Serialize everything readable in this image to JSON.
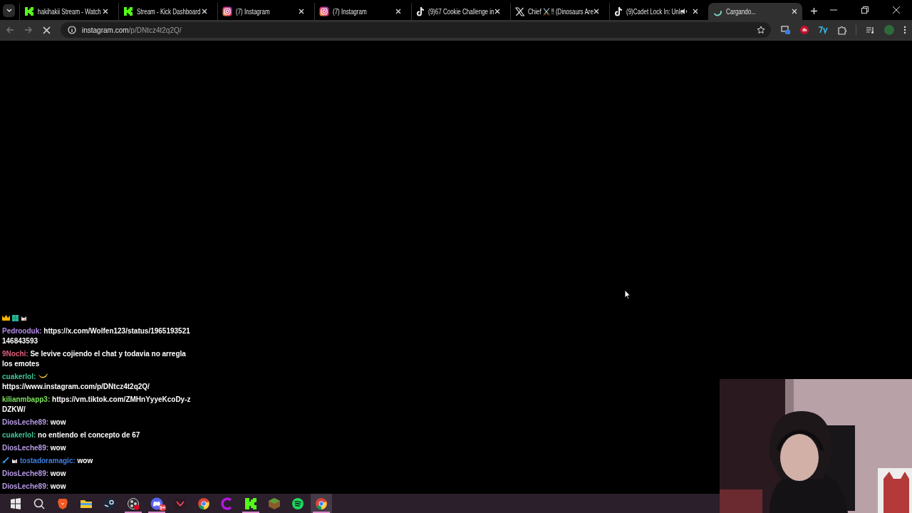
{
  "tabs": [
    {
      "title": "hakihakii Stream - Watch",
      "kind": "kick",
      "audio": false,
      "selected": false
    },
    {
      "title": "Stream - Kick Dashboard",
      "kind": "kick",
      "audio": false,
      "selected": false
    },
    {
      "title": "(7) Instagram",
      "kind": "instagram",
      "audio": false,
      "selected": false
    },
    {
      "title": "(7) Instagram",
      "kind": "instagram",
      "audio": false,
      "selected": false
    },
    {
      "title": "(9)67 Cookie Challenge in",
      "kind": "tiktok",
      "audio": false,
      "selected": false
    },
    {
      "title": "Chief ⚔️ ‼ (Dinosaurs Are",
      "kind": "x",
      "audio": false,
      "selected": false
    },
    {
      "title": "(9)Cadet Lock In: Unle",
      "kind": "tiktok",
      "audio": true,
      "selected": false
    },
    {
      "title": "Cargando...",
      "kind": "loading",
      "audio": false,
      "selected": true
    }
  ],
  "toolbar": {
    "loading": true,
    "host": "instagram.com",
    "path": "/p/DNtcz4t2q2Q/"
  },
  "chat": [
    {
      "kind": "badges",
      "badges": [
        {
          "kind": "crown"
        },
        {
          "kind": "grid"
        },
        {
          "kind": "cat"
        }
      ]
    },
    {
      "kind": "message",
      "user": "Pedrooduk:",
      "color": "#b48bea",
      "text": "https://x.com/Wolfen123/status/1965193521146843593"
    },
    {
      "kind": "message",
      "user": "9Nochi:",
      "color": "#e0607e",
      "text": "Se levive cojiendo el chat y todavia no arregla los emotes"
    },
    {
      "kind": "message",
      "user": "cuakerlol:",
      "color": "#3fc49a",
      "emote": true,
      "text": "https://www.instagram.com/p/DNtcz4t2q2Q/"
    },
    {
      "kind": "message",
      "user": "kilianmbapp3:",
      "color": "#7de25b",
      "text": "https://vm.tiktok.com/ZMHnYyyeKcoDy-zDZKW/"
    },
    {
      "kind": "message",
      "user": "DiosLeche89:",
      "color": "#b89ae6",
      "text": "wow"
    },
    {
      "kind": "message",
      "user": "cuakerlol:",
      "color": "#3fc49a",
      "text": "no entiendo el concepto de 67"
    },
    {
      "kind": "message",
      "user": "DiosLeche89:",
      "color": "#b89ae6",
      "text": "wow"
    },
    {
      "kind": "message",
      "badges": [
        {
          "kind": "sword"
        },
        {
          "kind": "cat"
        }
      ],
      "user": "tostadoramagic:",
      "color": "#3f7fe0",
      "text": "wow"
    },
    {
      "kind": "message",
      "user": "DiosLeche89:",
      "color": "#b89ae6",
      "text": "wow"
    },
    {
      "kind": "message",
      "user": "DiosLeche89:",
      "color": "#b89ae6",
      "text": "wow"
    }
  ],
  "taskbar": [
    {
      "kind": "windows",
      "running": false,
      "active": false
    },
    {
      "kind": "search",
      "running": false,
      "active": false
    },
    {
      "kind": "brave",
      "running": false,
      "active": false
    },
    {
      "kind": "folder",
      "running": false,
      "active": false
    },
    {
      "kind": "steam",
      "running": false,
      "active": false
    },
    {
      "kind": "obs",
      "running": true,
      "active": false
    },
    {
      "kind": "discord",
      "running": true,
      "active": false,
      "badge": "9+"
    },
    {
      "kind": "valorant",
      "running": false,
      "active": false
    },
    {
      "kind": "chrome",
      "running": false,
      "active": false
    },
    {
      "kind": "canva",
      "running": false,
      "active": false
    },
    {
      "kind": "kick",
      "running": true,
      "active": false
    },
    {
      "kind": "minecraft",
      "running": false,
      "active": false
    },
    {
      "kind": "spotify",
      "running": false,
      "active": false
    },
    {
      "kind": "chrome",
      "running": true,
      "active": true
    }
  ]
}
